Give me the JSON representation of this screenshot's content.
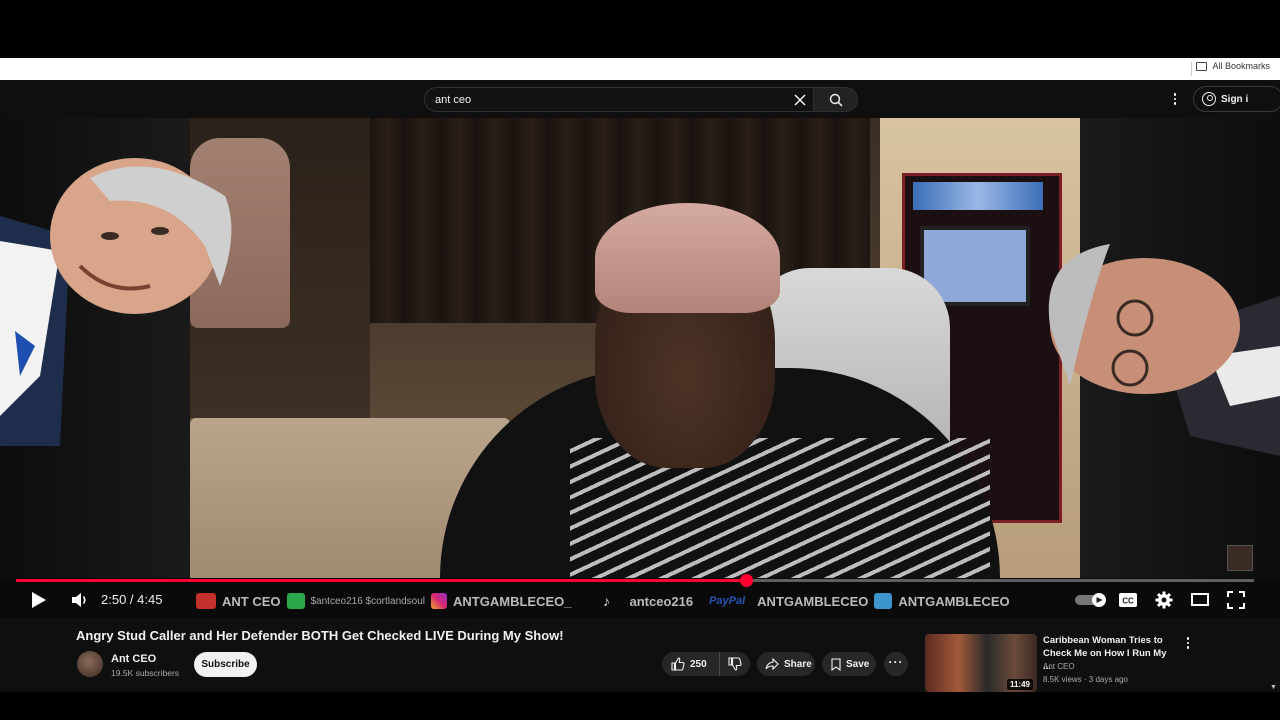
{
  "browser": {
    "bookmarks_label": "All Bookmarks"
  },
  "header": {
    "search_value": "ant ceo",
    "sign_in_label": "Sign i"
  },
  "player": {
    "time_current": "2:50",
    "time_total": "4:45",
    "time_display": "2:50 / 4:45",
    "progress_fraction": 0.59,
    "ticker": {
      "youtube_label": "ANT CEO",
      "cashapp_label": "$antceo216 $cortlandsoul",
      "instagram_label": "ANTGAMBLECEO_",
      "tiktok_label": "antceo216",
      "paypal_brand": "PayPal",
      "paypal_label": "ANTGAMBLECEO",
      "venmo_label": "ANTGAMBLECEO"
    }
  },
  "video": {
    "title": "Angry Stud Caller and Her Defender BOTH Get Checked LIVE During My Show!",
    "channel_name": "Ant CEO",
    "subscribers": "19.5K subscribers",
    "subscribe_label": "Subscribe",
    "likes": "250",
    "share_label": "Share",
    "save_label": "Save"
  },
  "recommendation": {
    "title": "Caribbean Woman Tries to Check Me on How I Run My ...",
    "channel": "Ant CEO",
    "meta": "8.5K views · 3 days ago",
    "duration": "11:49"
  },
  "colors": {
    "accent_red": "#ff0033",
    "bg": "#0f0f0f"
  }
}
